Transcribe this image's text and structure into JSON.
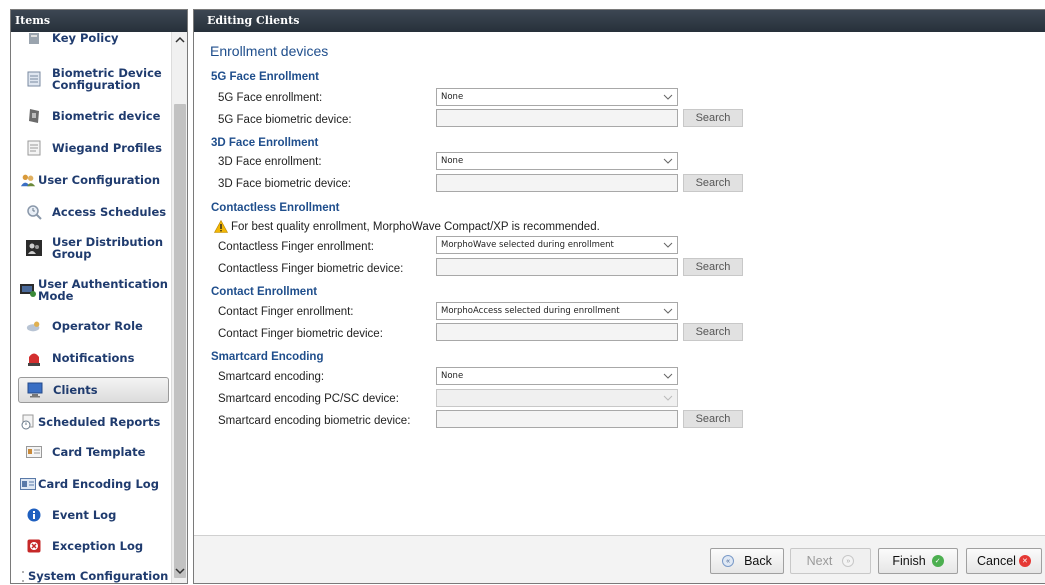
{
  "sidebar": {
    "title": "Items",
    "items": [
      {
        "label": "Key Policy",
        "icon": "key-policy-icon"
      },
      {
        "label": "Biometric Device Configuration",
        "icon": "document-icon"
      },
      {
        "label": "Biometric device",
        "icon": "biometric-device-icon"
      },
      {
        "label": "Wiegand Profiles",
        "icon": "list-document-icon"
      },
      {
        "label": "User Configuration",
        "icon": "users-icon"
      },
      {
        "label": "Access Schedules",
        "icon": "magnifier-clock-icon"
      },
      {
        "label": "User Distribution Group",
        "icon": "user-group-icon"
      },
      {
        "label": "User Authentication Mode",
        "icon": "user-auth-icon"
      },
      {
        "label": "Operator Role",
        "icon": "operator-role-icon"
      },
      {
        "label": "Notifications",
        "icon": "alarm-light-icon"
      },
      {
        "label": "Clients",
        "icon": "monitor-icon",
        "selected": true
      },
      {
        "label": "Scheduled Reports",
        "icon": "scheduled-report-icon"
      },
      {
        "label": "Card Template",
        "icon": "card-template-icon"
      },
      {
        "label": "Card Encoding Log",
        "icon": "card-log-icon"
      },
      {
        "label": "Event Log",
        "icon": "info-icon"
      },
      {
        "label": "Exception Log",
        "icon": "exception-icon"
      },
      {
        "label": "System Configuration",
        "icon": "system-config-icon"
      }
    ]
  },
  "main": {
    "title": "Editing Clients",
    "section_title": "Enrollment devices",
    "groups": {
      "face5g": {
        "title": "5G Face Enrollment",
        "enroll_label": "5G Face enrollment:",
        "enroll_value": "None",
        "device_label": "5G Face biometric device:",
        "device_value": "",
        "search": "Search"
      },
      "face3d": {
        "title": "3D Face Enrollment",
        "enroll_label": "3D Face enrollment:",
        "enroll_value": "None",
        "device_label": "3D Face biometric device:",
        "device_value": "",
        "search": "Search"
      },
      "contactless": {
        "title": "Contactless Enrollment",
        "warning": "For best quality enrollment, MorphoWave Compact/XP is recommended.",
        "enroll_label": "Contactless Finger enrollment:",
        "enroll_value": "MorphoWave selected during enrollment",
        "device_label": "Contactless Finger biometric device:",
        "device_value": "",
        "search": "Search"
      },
      "contact": {
        "title": "Contact Enrollment",
        "enroll_label": "Contact Finger enrollment:",
        "enroll_value": "MorphoAccess selected during enrollment",
        "device_label": "Contact Finger biometric device:",
        "device_value": "",
        "search": "Search"
      },
      "smartcard": {
        "title": "Smartcard Encoding",
        "encoding_label": "Smartcard encoding:",
        "encoding_value": "None",
        "pcsc_label": "Smartcard encoding PC/SC device:",
        "pcsc_value": "",
        "device_label": "Smartcard encoding biometric device:",
        "device_value": "",
        "search": "Search"
      }
    }
  },
  "footer": {
    "back": "Back",
    "next": "Next",
    "finish": "Finish",
    "cancel": "Cancel"
  },
  "colors": {
    "titlebar": "#2f3843",
    "heading": "#1f4e8c",
    "sidebar_label": "#1f3b6e",
    "finish_icon": "#4caf50",
    "cancel_icon": "#e53935",
    "warning": "#f2b705"
  }
}
